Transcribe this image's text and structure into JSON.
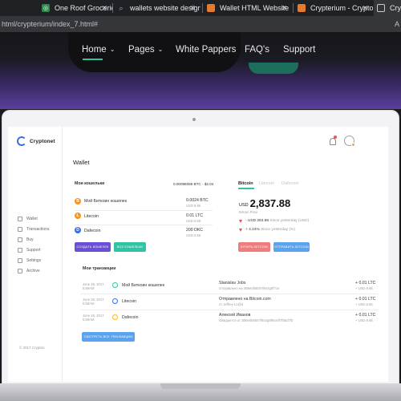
{
  "browser": {
    "tabs": [
      {
        "title": "One Roof Groceries",
        "color": "#2d8a4e"
      },
      {
        "title": "wallets website design",
        "color": "#4285f4"
      },
      {
        "title": "Wallet HTML Website",
        "color": "#e37b2f"
      },
      {
        "title": "Crypterium - Cryptocu",
        "color": "#e37b2f"
      },
      {
        "title": "Crypt",
        "color": "#cccccc"
      }
    ],
    "url": "html/crypterium/index_7.html#",
    "addr_right": "A"
  },
  "site_nav": {
    "items": [
      "Home",
      "Pages",
      "White Pappers",
      "FAQ's",
      "Support"
    ],
    "active": "Home"
  },
  "app": {
    "logo": "Cryptonet",
    "sidebar": [
      "Wallet",
      "Transactions",
      "Buy",
      "Support",
      "Settings",
      "Archive"
    ],
    "footer": "© 2017 Crypton",
    "page_title": "Wallet",
    "wallets": {
      "title": "Мои кошельки",
      "total": "0.00098095 BTC - $2.04",
      "rows": [
        {
          "name": "Мой Биткоин кошелек",
          "amount": "0.0024 BTC",
          "usd": "USD 6.96",
          "color": "#f7931a",
          "letter": "B"
        },
        {
          "name": "Litecoin",
          "amount": "0.01 LTC",
          "usd": "USD 0.66",
          "color": "#f7931a",
          "letter": "Ł"
        },
        {
          "name": "Dafecoin",
          "amount": "200 DKC",
          "usd": "USD 0.66",
          "color": "#3a6fe0",
          "letter": "D"
        }
      ],
      "btn_create": "СОЗДАТЬ КОШЕЛЕК",
      "btn_all": "ВСЕ КОШЕЛЬКИ"
    },
    "rates": {
      "tabs": [
        "Bitcoin",
        "Litecoin",
        "Dafecoin"
      ],
      "currency": "USD",
      "price": "2,837.88",
      "price_label": "Bitcoin Price",
      "changes": [
        {
          "value": "- USD 283.88",
          "label": "Since yesterday (USD)"
        },
        {
          "value": "+ 4.24%",
          "label": "Since yesterday (%)"
        }
      ],
      "btn_buy": "КУПИТЬ BITCOIN",
      "btn_send": "ОТПРАВИТЬ BITCOIN"
    },
    "transactions": {
      "title": "Мои транзакции",
      "rows": [
        {
          "date": "June 26, 2017",
          "time": "5:59AM",
          "wallet": "Мой Биткоин кошелек",
          "party": "Stanislav Jobs",
          "sub": "Отправлено на 3B6e0b6b07f6e2g9f7ce",
          "amount": "+ 0.01 LTC",
          "usd": "+ USD 6.66",
          "color": "#2fc4a3"
        },
        {
          "date": "June 26, 2017",
          "time": "5:59AM",
          "wallet": "Litecoin",
          "party": "Отправлено на Bitcoin.com",
          "sub": "от Jeffrey Lo@it",
          "amount": "+ 0.01 LTC",
          "usd": "+ USD 6.66",
          "color": "#3a6fe0"
        },
        {
          "date": "June 26, 2017",
          "time": "5:59AM",
          "wallet": "Dafecoin",
          "party": "Алексей Иванов",
          "sub": "Ожидается от 3B6e0b6b07f6e2g9f6ce0f7f5bd7f0",
          "amount": "+ 0.01 LTC",
          "usd": "+ USD 6.66",
          "color": "#f7b731"
        }
      ],
      "btn_all": "СМОТРЕТЬ ВСЕ ТРАНЗАКЦИИ"
    }
  }
}
